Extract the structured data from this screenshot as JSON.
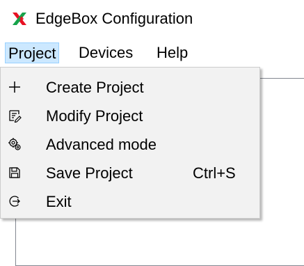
{
  "window": {
    "title": "EdgeBox Configuration",
    "icon": "red-green-x-icon",
    "icon_colors": [
      "#e81123",
      "#16a34a"
    ]
  },
  "menubar": {
    "items": [
      {
        "label": "Project",
        "active": true
      },
      {
        "label": "Devices",
        "active": false
      },
      {
        "label": "Help",
        "active": false
      }
    ],
    "active_highlight": "#cce8ff"
  },
  "project_menu": {
    "items": [
      {
        "label": "Create Project",
        "icon": "plus-icon",
        "shortcut": ""
      },
      {
        "label": "Modify Project",
        "icon": "edit-document-icon",
        "shortcut": ""
      },
      {
        "label": "Advanced mode",
        "icon": "advanced-settings-icon",
        "shortcut": ""
      },
      {
        "label": "Save Project",
        "icon": "save-icon",
        "shortcut": "Ctrl+S"
      },
      {
        "label": "Exit",
        "icon": "exit-icon",
        "shortcut": ""
      }
    ]
  }
}
